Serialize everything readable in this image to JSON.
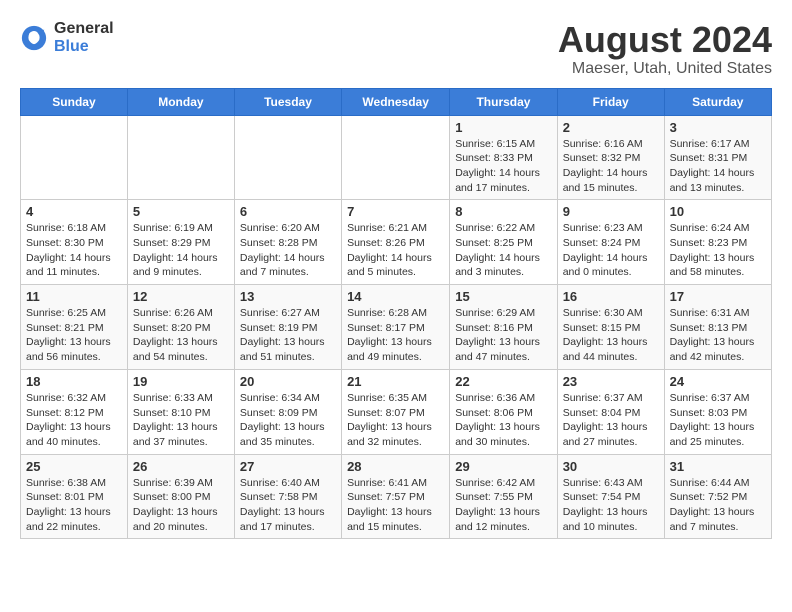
{
  "header": {
    "logo_general": "General",
    "logo_blue": "Blue",
    "month_year": "August 2024",
    "location": "Maeser, Utah, United States"
  },
  "days_of_week": [
    "Sunday",
    "Monday",
    "Tuesday",
    "Wednesday",
    "Thursday",
    "Friday",
    "Saturday"
  ],
  "weeks": [
    [
      {
        "day": "",
        "info": ""
      },
      {
        "day": "",
        "info": ""
      },
      {
        "day": "",
        "info": ""
      },
      {
        "day": "",
        "info": ""
      },
      {
        "day": "1",
        "info": "Sunrise: 6:15 AM\nSunset: 8:33 PM\nDaylight: 14 hours\nand 17 minutes."
      },
      {
        "day": "2",
        "info": "Sunrise: 6:16 AM\nSunset: 8:32 PM\nDaylight: 14 hours\nand 15 minutes."
      },
      {
        "day": "3",
        "info": "Sunrise: 6:17 AM\nSunset: 8:31 PM\nDaylight: 14 hours\nand 13 minutes."
      }
    ],
    [
      {
        "day": "4",
        "info": "Sunrise: 6:18 AM\nSunset: 8:30 PM\nDaylight: 14 hours\nand 11 minutes."
      },
      {
        "day": "5",
        "info": "Sunrise: 6:19 AM\nSunset: 8:29 PM\nDaylight: 14 hours\nand 9 minutes."
      },
      {
        "day": "6",
        "info": "Sunrise: 6:20 AM\nSunset: 8:28 PM\nDaylight: 14 hours\nand 7 minutes."
      },
      {
        "day": "7",
        "info": "Sunrise: 6:21 AM\nSunset: 8:26 PM\nDaylight: 14 hours\nand 5 minutes."
      },
      {
        "day": "8",
        "info": "Sunrise: 6:22 AM\nSunset: 8:25 PM\nDaylight: 14 hours\nand 3 minutes."
      },
      {
        "day": "9",
        "info": "Sunrise: 6:23 AM\nSunset: 8:24 PM\nDaylight: 14 hours\nand 0 minutes."
      },
      {
        "day": "10",
        "info": "Sunrise: 6:24 AM\nSunset: 8:23 PM\nDaylight: 13 hours\nand 58 minutes."
      }
    ],
    [
      {
        "day": "11",
        "info": "Sunrise: 6:25 AM\nSunset: 8:21 PM\nDaylight: 13 hours\nand 56 minutes."
      },
      {
        "day": "12",
        "info": "Sunrise: 6:26 AM\nSunset: 8:20 PM\nDaylight: 13 hours\nand 54 minutes."
      },
      {
        "day": "13",
        "info": "Sunrise: 6:27 AM\nSunset: 8:19 PM\nDaylight: 13 hours\nand 51 minutes."
      },
      {
        "day": "14",
        "info": "Sunrise: 6:28 AM\nSunset: 8:17 PM\nDaylight: 13 hours\nand 49 minutes."
      },
      {
        "day": "15",
        "info": "Sunrise: 6:29 AM\nSunset: 8:16 PM\nDaylight: 13 hours\nand 47 minutes."
      },
      {
        "day": "16",
        "info": "Sunrise: 6:30 AM\nSunset: 8:15 PM\nDaylight: 13 hours\nand 44 minutes."
      },
      {
        "day": "17",
        "info": "Sunrise: 6:31 AM\nSunset: 8:13 PM\nDaylight: 13 hours\nand 42 minutes."
      }
    ],
    [
      {
        "day": "18",
        "info": "Sunrise: 6:32 AM\nSunset: 8:12 PM\nDaylight: 13 hours\nand 40 minutes."
      },
      {
        "day": "19",
        "info": "Sunrise: 6:33 AM\nSunset: 8:10 PM\nDaylight: 13 hours\nand 37 minutes."
      },
      {
        "day": "20",
        "info": "Sunrise: 6:34 AM\nSunset: 8:09 PM\nDaylight: 13 hours\nand 35 minutes."
      },
      {
        "day": "21",
        "info": "Sunrise: 6:35 AM\nSunset: 8:07 PM\nDaylight: 13 hours\nand 32 minutes."
      },
      {
        "day": "22",
        "info": "Sunrise: 6:36 AM\nSunset: 8:06 PM\nDaylight: 13 hours\nand 30 minutes."
      },
      {
        "day": "23",
        "info": "Sunrise: 6:37 AM\nSunset: 8:04 PM\nDaylight: 13 hours\nand 27 minutes."
      },
      {
        "day": "24",
        "info": "Sunrise: 6:37 AM\nSunset: 8:03 PM\nDaylight: 13 hours\nand 25 minutes."
      }
    ],
    [
      {
        "day": "25",
        "info": "Sunrise: 6:38 AM\nSunset: 8:01 PM\nDaylight: 13 hours\nand 22 minutes."
      },
      {
        "day": "26",
        "info": "Sunrise: 6:39 AM\nSunset: 8:00 PM\nDaylight: 13 hours\nand 20 minutes."
      },
      {
        "day": "27",
        "info": "Sunrise: 6:40 AM\nSunset: 7:58 PM\nDaylight: 13 hours\nand 17 minutes."
      },
      {
        "day": "28",
        "info": "Sunrise: 6:41 AM\nSunset: 7:57 PM\nDaylight: 13 hours\nand 15 minutes."
      },
      {
        "day": "29",
        "info": "Sunrise: 6:42 AM\nSunset: 7:55 PM\nDaylight: 13 hours\nand 12 minutes."
      },
      {
        "day": "30",
        "info": "Sunrise: 6:43 AM\nSunset: 7:54 PM\nDaylight: 13 hours\nand 10 minutes."
      },
      {
        "day": "31",
        "info": "Sunrise: 6:44 AM\nSunset: 7:52 PM\nDaylight: 13 hours\nand 7 minutes."
      }
    ]
  ]
}
